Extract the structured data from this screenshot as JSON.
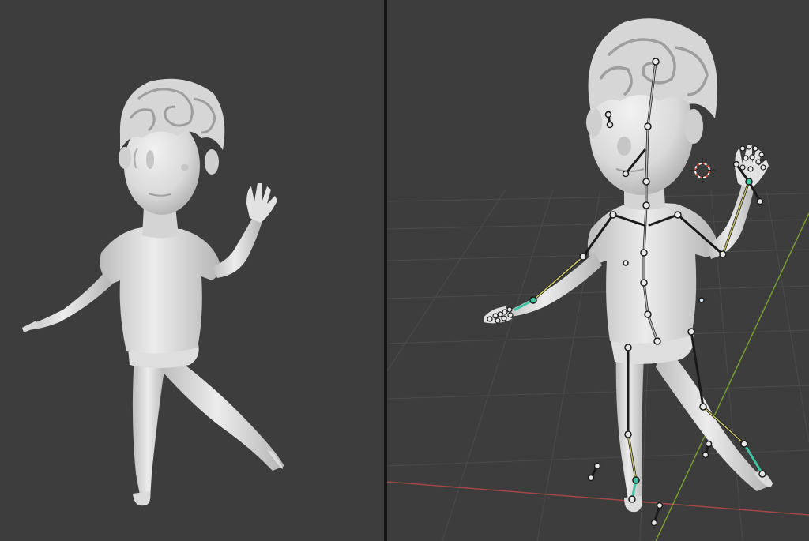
{
  "viewports": {
    "left": {
      "mode": "solid-shading",
      "object": "character-mesh"
    },
    "right": {
      "mode": "solid-shading-armature-overlay",
      "object": "character-mesh-with-rig",
      "grid": true
    }
  },
  "colors": {
    "viewport_bg": "#3d3d3d",
    "divider": "#151515",
    "grid_line": "#4a4a4a",
    "x_axis": "#a04848",
    "y_axis": "#7a9a30",
    "mesh_light": "#e6e6e6",
    "mesh_mid": "#c8c8c8",
    "mesh_shadow": "#9a9a9a",
    "bone_outline": "#1a1a1a",
    "bone_fill": "#b9b9b9",
    "bone_ik": "#c9c86a",
    "bone_selected": "#3fc3a0",
    "cursor_red": "#e84a3a"
  },
  "icons": [
    "3d-cursor-icon"
  ]
}
